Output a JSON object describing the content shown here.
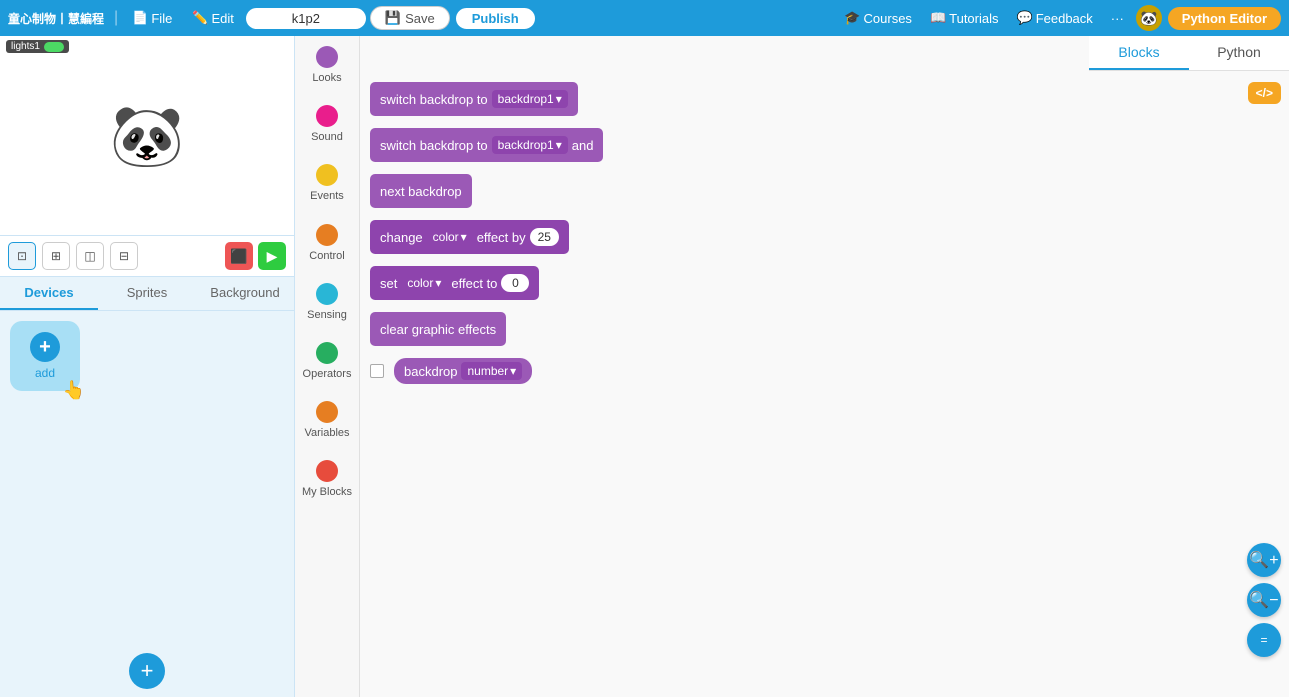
{
  "topNav": {
    "logo": "童心制物丨慧編程",
    "file": "File",
    "edit": "Edit",
    "projectName": "k1p2",
    "save": "Save",
    "publish": "Publish",
    "courses": "Courses",
    "tutorials": "Tutorials",
    "feedback": "Feedback",
    "pythonEditor": "Python Editor"
  },
  "stageLabel": {
    "label": "lights1",
    "toggle": "on"
  },
  "tabs": {
    "devices": "Devices",
    "sprites": "Sprites",
    "background": "Background"
  },
  "addBtn": "add",
  "categories": [
    {
      "id": "looks",
      "label": "Looks",
      "color": "cat-looks"
    },
    {
      "id": "sound",
      "label": "Sound",
      "color": "cat-sound"
    },
    {
      "id": "events",
      "label": "Events",
      "color": "cat-events"
    },
    {
      "id": "control",
      "label": "Control",
      "color": "cat-control"
    },
    {
      "id": "sensing",
      "label": "Sensing",
      "color": "cat-sensing"
    },
    {
      "id": "operators",
      "label": "Operators",
      "color": "cat-operators"
    },
    {
      "id": "variables",
      "label": "Variables",
      "color": "cat-variables"
    },
    {
      "id": "myblocks",
      "label": "My Blocks",
      "color": "cat-myblocks"
    }
  ],
  "blocks": [
    {
      "id": "switch_backdrop_to",
      "text": "switch backdrop to",
      "dropdown": "backdrop1",
      "type": "purple"
    },
    {
      "id": "switch_backdrop_wait",
      "text": "switch backdrop to",
      "dropdown": "backdrop1",
      "extra": "and",
      "type": "purple"
    },
    {
      "id": "next_backdrop",
      "text": "next backdrop",
      "type": "purple"
    },
    {
      "id": "change_color_effect",
      "text": "change",
      "dropdown1": "color",
      "mid": "effect by",
      "value": "25",
      "type": "dark_purple"
    },
    {
      "id": "set_color_effect",
      "text": "set",
      "dropdown1": "color",
      "mid": "effect to",
      "value": "0",
      "type": "dark_purple"
    },
    {
      "id": "clear_graphic_effects",
      "text": "clear graphic effects",
      "type": "purple"
    },
    {
      "id": "backdrop_number",
      "text": "backdrop",
      "dropdown": "number",
      "type": "reporter",
      "hasCheckbox": true
    }
  ],
  "rightTabs": {
    "blocks": "Blocks",
    "python": "Python"
  },
  "zoomIn": "+",
  "zoomOut": "−",
  "xmlIcon": "</>"
}
